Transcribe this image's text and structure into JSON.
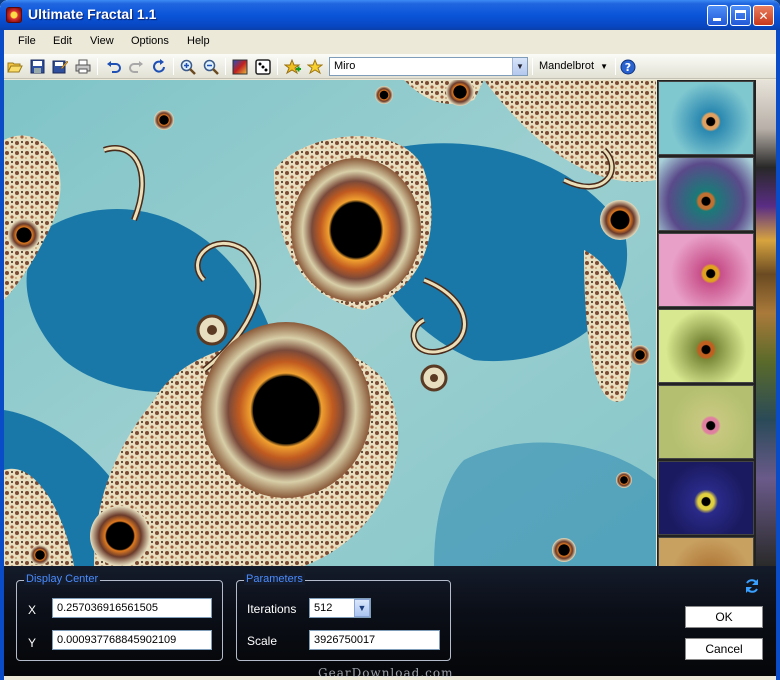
{
  "window": {
    "title": "Ultimate Fractal 1.1"
  },
  "menu": {
    "items": [
      "File",
      "Edit",
      "View",
      "Options",
      "Help"
    ]
  },
  "toolbar": {
    "icons": [
      "open-icon",
      "save-icon",
      "save-as-icon",
      "print-icon",
      "undo-icon",
      "redo-icon",
      "reset-icon",
      "zoom-in-icon",
      "zoom-out-icon",
      "palette-icon",
      "random-icon",
      "add-favorite-icon",
      "favorite-star-icon",
      "help-icon"
    ],
    "palette_value": "Miro",
    "fractal_type": "Mandelbrot"
  },
  "display_center": {
    "legend": "Display Center",
    "x_label": "X",
    "x_value": "0.257036916561505",
    "y_label": "Y",
    "y_value": "0.000937768845902109"
  },
  "parameters": {
    "legend": "Parameters",
    "iterations_label": "Iterations",
    "iterations_value": "512",
    "scale_label": "Scale",
    "scale_value": "3926750017"
  },
  "buttons": {
    "ok": "OK",
    "cancel": "Cancel"
  },
  "watermark": "GearDownload.com",
  "colors": {
    "title_bar": "#0a55d9",
    "sea": "#1c79a8",
    "sky": "#8cc9cb",
    "legend": "#4a8cff"
  }
}
